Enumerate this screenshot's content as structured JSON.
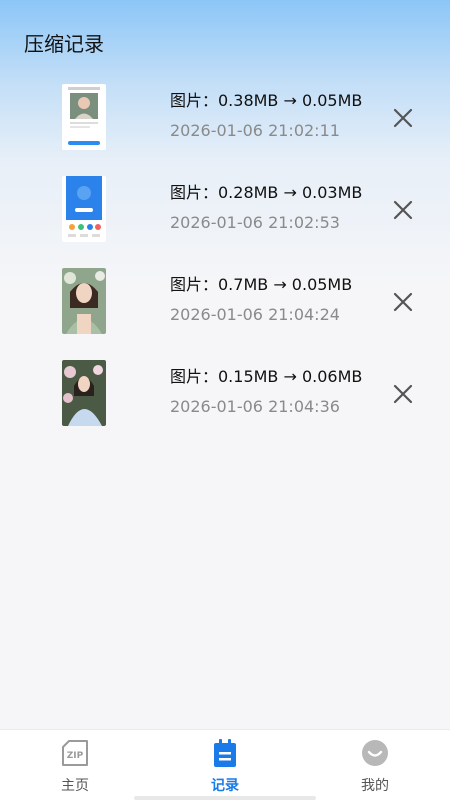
{
  "header": {
    "title": "压缩记录"
  },
  "records": [
    {
      "size": "图片：0.38MB → 0.05MB",
      "time": "2026-01-06 21:02:11",
      "thumb_icon": "profile-screenshot-thumbnail"
    },
    {
      "size": "图片：0.28MB → 0.03MB",
      "time": "2026-01-06 21:02:53",
      "thumb_icon": "app-screenshot-thumbnail"
    },
    {
      "size": "图片：0.7MB → 0.05MB",
      "time": "2026-01-06 21:04:24",
      "thumb_icon": "portrait-photo-thumbnail"
    },
    {
      "size": "图片：0.15MB → 0.06MB",
      "time": "2026-01-06 21:04:36",
      "thumb_icon": "portrait-photo-thumbnail"
    }
  ],
  "nav": {
    "items": [
      {
        "label": "主页",
        "icon": "zip-icon"
      },
      {
        "label": "记录",
        "icon": "record-icon"
      },
      {
        "label": "我的",
        "icon": "smile-icon"
      }
    ],
    "active_index": 1
  },
  "colors": {
    "accent": "#1a7be8",
    "header_gradient_top": "#8cc6f7",
    "background": "#f6f6f8",
    "secondary_text": "#8a8a8a"
  }
}
